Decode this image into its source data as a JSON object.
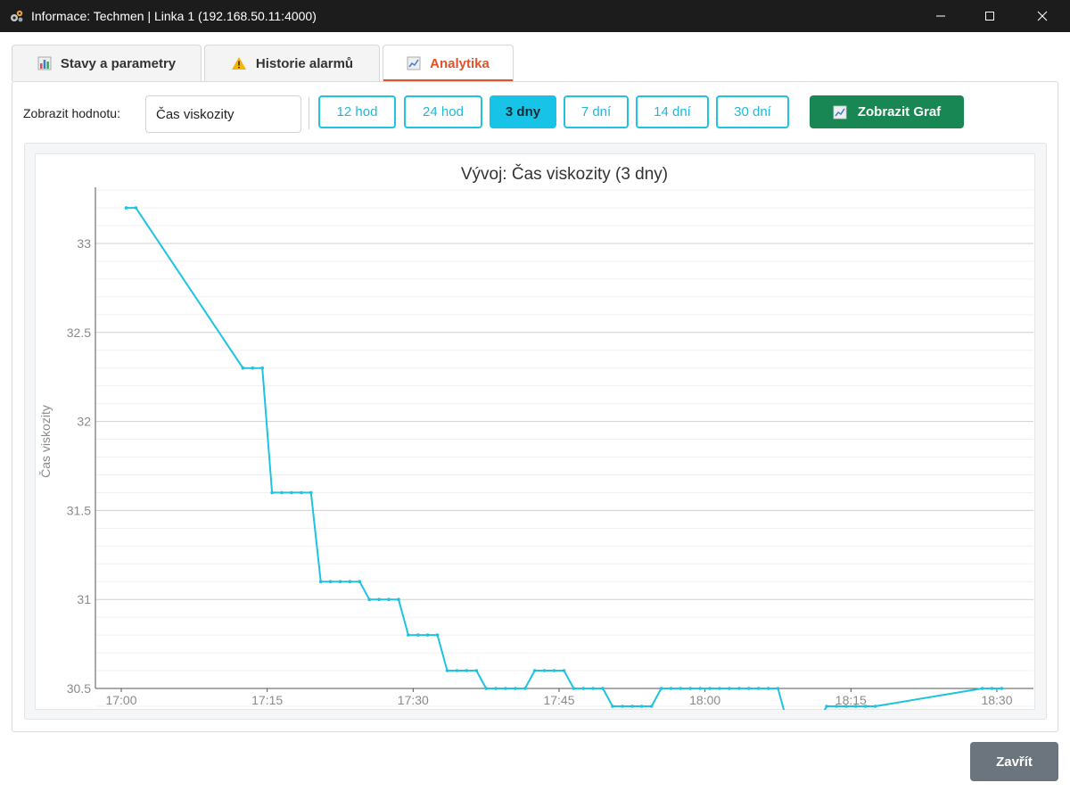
{
  "window": {
    "title": "Informace: Techmen | Linka 1  (192.168.50.11:4000)",
    "app_icon": "gear-cluster-icon"
  },
  "tabs": [
    {
      "label": "Stavy a parametry",
      "icon": "bar-chart-icon",
      "active": false
    },
    {
      "label": "Historie alarmů",
      "icon": "warning-icon",
      "active": false
    },
    {
      "label": "Analytika",
      "icon": "line-chart-icon",
      "active": true
    }
  ],
  "toolbar": {
    "show_label": "Zobrazit hodnotu:",
    "selected_value": "Čas viskozity",
    "ranges": [
      {
        "label": "12 hod",
        "active": false
      },
      {
        "label": "24 hod",
        "active": false
      },
      {
        "label": "3 dny",
        "active": true
      },
      {
        "label": "7 dní",
        "active": false
      },
      {
        "label": "14 dní",
        "active": false
      },
      {
        "label": "30 dní",
        "active": false
      }
    ],
    "show_graph_label": "Zobrazit Graf"
  },
  "colors": {
    "accent": "#e0522a",
    "range_button": "#22c3e2",
    "series": "#1ec2e2",
    "graph_button": "#198754",
    "close_button": "#6c757d"
  },
  "chart_data": {
    "type": "line",
    "title": "Vývoj: Čas viskozity (3 dny)",
    "xlabel": "",
    "ylabel": "Čas viskozity",
    "xlim": [
      "17:00",
      "18:30"
    ],
    "ylim": [
      30.3,
      33.3
    ],
    "x_ticks": [
      "17:00",
      "17:15",
      "17:30",
      "17:45",
      "18:00",
      "18:15",
      "18:30"
    ],
    "y_ticks": [
      30.5,
      31,
      31.5,
      32,
      32.5,
      33
    ],
    "grid": true,
    "legend": "none",
    "series": [
      {
        "x": [
          "17:00:30",
          "17:01:30",
          "17:12:30",
          "17:13:30",
          "17:14:30",
          "17:15:30",
          "17:16:30",
          "17:17:30",
          "17:18:30",
          "17:19:30",
          "17:20:30",
          "17:21:30",
          "17:22:30",
          "17:23:30",
          "17:24:30",
          "17:25:30",
          "17:26:30",
          "17:27:30",
          "17:28:30",
          "17:29:30",
          "17:30:30",
          "17:31:30",
          "17:32:30",
          "17:33:30",
          "17:34:30",
          "17:35:30",
          "17:36:30",
          "17:37:30",
          "17:38:30",
          "17:39:30",
          "17:40:30",
          "17:41:30",
          "17:42:30",
          "17:43:30",
          "17:44:30",
          "17:45:30",
          "17:46:30",
          "17:47:30",
          "17:48:30",
          "17:49:30",
          "17:50:30",
          "17:51:30",
          "17:52:30",
          "17:53:30",
          "17:54:30",
          "17:55:30",
          "17:56:30",
          "17:57:30",
          "17:58:30",
          "17:59:30",
          "18:00:30",
          "18:01:30",
          "18:02:30",
          "18:03:30",
          "18:04:30",
          "18:05:30",
          "18:06:30",
          "18:07:30",
          "18:08:30",
          "18:09:30",
          "18:10:30",
          "18:11:30",
          "18:12:30",
          "18:13:30",
          "18:14:30",
          "18:15:30",
          "18:16:30",
          "18:17:30",
          "18:28:30",
          "18:29:30",
          "18:30:30"
        ],
        "y": [
          33.2,
          33.2,
          32.3,
          32.3,
          32.3,
          31.6,
          31.6,
          31.6,
          31.6,
          31.6,
          31.1,
          31.1,
          31.1,
          31.1,
          31.1,
          31.0,
          31.0,
          31.0,
          31.0,
          30.8,
          30.8,
          30.8,
          30.8,
          30.6,
          30.6,
          30.6,
          30.6,
          30.5,
          30.5,
          30.5,
          30.5,
          30.5,
          30.6,
          30.6,
          30.6,
          30.6,
          30.5,
          30.5,
          30.5,
          30.5,
          30.4,
          30.4,
          30.4,
          30.4,
          30.4,
          30.5,
          30.5,
          30.5,
          30.5,
          30.5,
          30.5,
          30.5,
          30.5,
          30.5,
          30.5,
          30.5,
          30.5,
          30.5,
          30.3,
          30.3,
          30.3,
          30.3,
          30.4,
          30.4,
          30.4,
          30.4,
          30.4,
          30.4,
          30.5,
          30.5,
          30.5
        ]
      }
    ]
  },
  "footer": {
    "close_label": "Zavřít"
  }
}
